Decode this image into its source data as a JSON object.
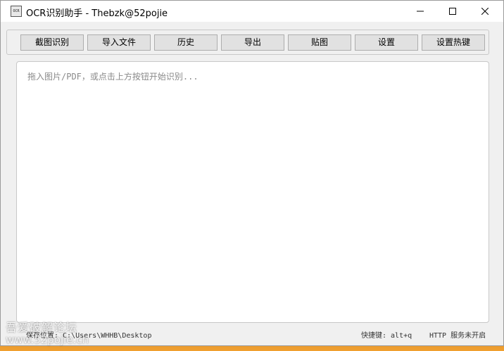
{
  "window": {
    "title": "OCR识别助手 - Thebzk@52pojie",
    "icon_label": "OCR"
  },
  "toolbar": {
    "buttons": [
      {
        "label": "截图识别"
      },
      {
        "label": "导入文件"
      },
      {
        "label": "历史"
      },
      {
        "label": "导出"
      },
      {
        "label": "贴图"
      },
      {
        "label": "设置"
      },
      {
        "label": "设置热键"
      }
    ]
  },
  "editor": {
    "placeholder": "拖入图片/PDF，或点击上方按钮开始识别..."
  },
  "status": {
    "save_location": "保存位置: C:\\Users\\WHHB\\Desktop",
    "shortcut": "快捷键: alt+q",
    "http": "HTTP 服务未开启"
  },
  "watermark": {
    "site_name": "吾爱破解论坛",
    "url": "www.52pojie.cn"
  },
  "icons": {
    "minimize": "minimize-icon",
    "maximize": "maximize-icon",
    "close": "close-icon"
  }
}
